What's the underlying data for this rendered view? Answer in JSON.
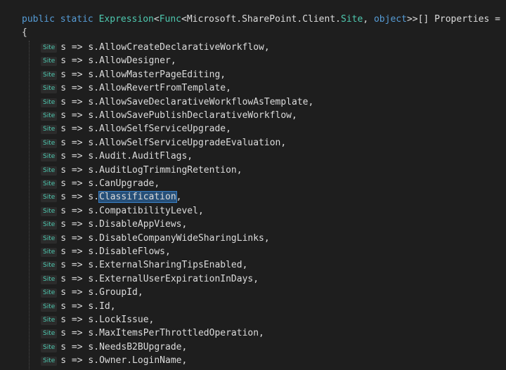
{
  "code": {
    "decl": {
      "kw1": "public",
      "kw2": "static",
      "type1": "Expression",
      "p1": "<",
      "type2": "Func",
      "p2": "<Microsoft.SharePoint.Client.",
      "type3": "Site",
      "p3": ", ",
      "kw3": "object",
      "p4": ">>[] Properties ="
    },
    "open_brace": "{",
    "hint_label": "Site",
    "lambda_prefix": "s => s.",
    "entries": [
      "AllowCreateDeclarativeWorkflow,",
      "AllowDesigner,",
      "AllowMasterPageEditing,",
      "AllowRevertFromTemplate,",
      "AllowSaveDeclarativeWorkflowAsTemplate,",
      "AllowSavePublishDeclarativeWorkflow,",
      "AllowSelfServiceUpgrade,",
      "AllowSelfServiceUpgradeEvaluation,",
      "Audit.AuditFlags,",
      "AuditLogTrimmingRetention,",
      "CanUpgrade,",
      "Classification,",
      "CompatibilityLevel,",
      "DisableAppViews,",
      "DisableCompanyWideSharingLinks,",
      "DisableFlows,",
      "ExternalSharingTipsEnabled,",
      "ExternalUserExpirationInDays,",
      "GroupId,",
      "Id,",
      "LockIssue,",
      "MaxItemsPerThrottledOperation,",
      "NeedsB2BUpgrade,",
      "Owner.LoginName,"
    ],
    "selected_word": "Classification",
    "colors": {
      "background": "#1e1e1e",
      "keyword": "#569cd6",
      "type": "#4ec9b0",
      "text": "#dcdcdc",
      "selection": "#264f78"
    }
  }
}
